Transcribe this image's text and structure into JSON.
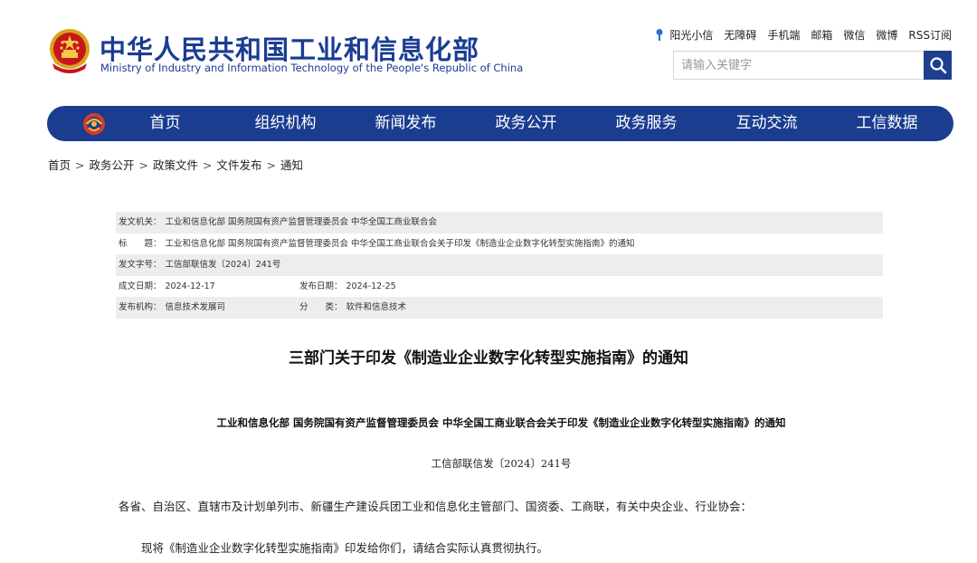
{
  "header": {
    "title_cn": "中华人民共和国工业和信息化部",
    "title_en": "Ministry of Industry and Information Technology of the People's Republic of China",
    "top_links": [
      "阳光小信",
      "无障碍",
      "手机端",
      "邮箱",
      "微信",
      "微博",
      "RSS订阅"
    ],
    "search": {
      "placeholder": "请输入关键字"
    }
  },
  "nav": {
    "items": [
      "首页",
      "组织机构",
      "新闻发布",
      "政务公开",
      "政务服务",
      "互动交流",
      "工信数据"
    ]
  },
  "breadcrumb": [
    "首页",
    "政务公开",
    "政策文件",
    "文件发布",
    "通知"
  ],
  "breadcrumb_separator": ">",
  "meta": {
    "issuer_label": "发文机关：",
    "issuer": "工业和信息化部 国务院国有资产监督管理委员会 中华全国工商业联合会",
    "title_label": "标　　题：",
    "title": "工业和信息化部 国务院国有资产监督管理委员会 中华全国工商业联合会关于印发《制造业企业数字化转型实施指南》的通知",
    "docno_label": "发文字号：",
    "docno": "工信部联信发〔2024〕241号",
    "written_label": "成文日期：",
    "written": "2024-12-17",
    "published_label": "发布日期：",
    "published": "2024-12-25",
    "org_label": "发布机构：",
    "org": "信息技术发展司",
    "category_label": "分　　类：",
    "category": "软件和信息技术"
  },
  "article": {
    "title": "三部门关于印发《制造业企业数字化转型实施指南》的通知",
    "subtitle": "工业和信息化部 国务院国有资产监督管理委员会 中华全国工商业联合会关于印发《制造业企业数字化转型实施指南》的通知",
    "doc_number": "工信部联信发〔2024〕241号",
    "para1": "各省、自治区、直辖市及计划单列市、新疆生产建设兵团工业和信息化主管部门、国资委、工商联，有关中央企业、行业协会：",
    "para2": "现将《制造业企业数字化转型实施指南》印发给你们，请结合实际认真贯彻执行。"
  },
  "colors": {
    "brand_blue": "#1a3d8f",
    "title_blue": "#1a3c93",
    "meta_row_grey": "#ededed"
  },
  "icons": {
    "emblem": "national-emblem-icon",
    "sun": "sun-icon",
    "search": "search-icon",
    "nav_logo": "miit-logo-icon"
  }
}
